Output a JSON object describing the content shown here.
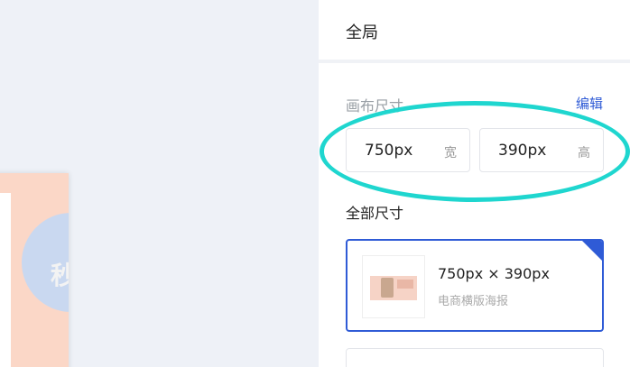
{
  "panel": {
    "title": "全局",
    "canvas_size_label": "画布尺寸",
    "edit_label": "编辑",
    "width": {
      "value": "750px",
      "unit": "宽"
    },
    "height": {
      "value": "390px",
      "unit": "高"
    },
    "all_sizes_label": "全部尺寸"
  },
  "preset": {
    "title": "750px × 390px",
    "subtitle": "电商横版海报",
    "selected": true
  },
  "colors": {
    "accent": "#2f5bd6",
    "highlight": "#1fd6cf",
    "canvas_bg": "#eef1f7"
  }
}
